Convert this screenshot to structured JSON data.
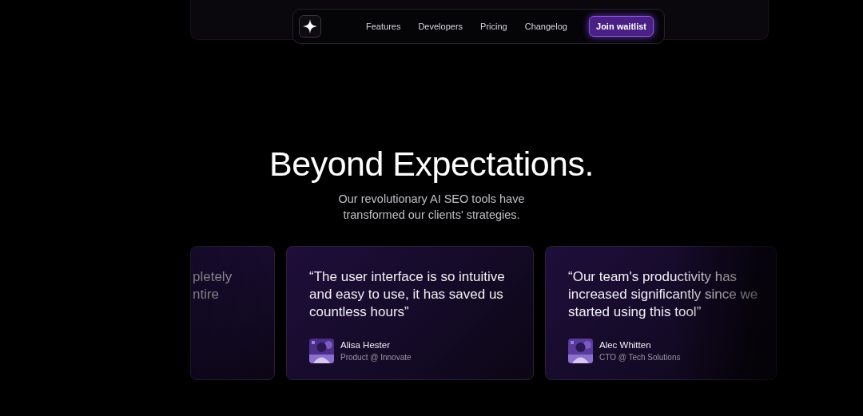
{
  "nav": {
    "links": [
      {
        "label": "Features"
      },
      {
        "label": "Developers"
      },
      {
        "label": "Pricing"
      },
      {
        "label": "Changelog"
      }
    ],
    "cta": "Join waitlist"
  },
  "hero": {
    "title": "Beyond Expectations.",
    "subtitle_lines": [
      "Our revolutionary AI SEO tools have",
      "transformed our clients' strategies."
    ]
  },
  "testimonials": [
    {
      "kind": "partial",
      "quote_lines": [
        "pletely",
        "ntire"
      ]
    },
    {
      "kind": "full",
      "quote": "“The user interface is so intuitive and easy to use, it has saved us countless hours”",
      "name": "Alisa Hester",
      "role": "Product @ Innovate"
    },
    {
      "kind": "faded",
      "quote": "“Our team's productivity has increased significantly since we started using this tool”",
      "name": "Alec Whitten",
      "role": "CTO @ Tech Solutions"
    }
  ]
}
